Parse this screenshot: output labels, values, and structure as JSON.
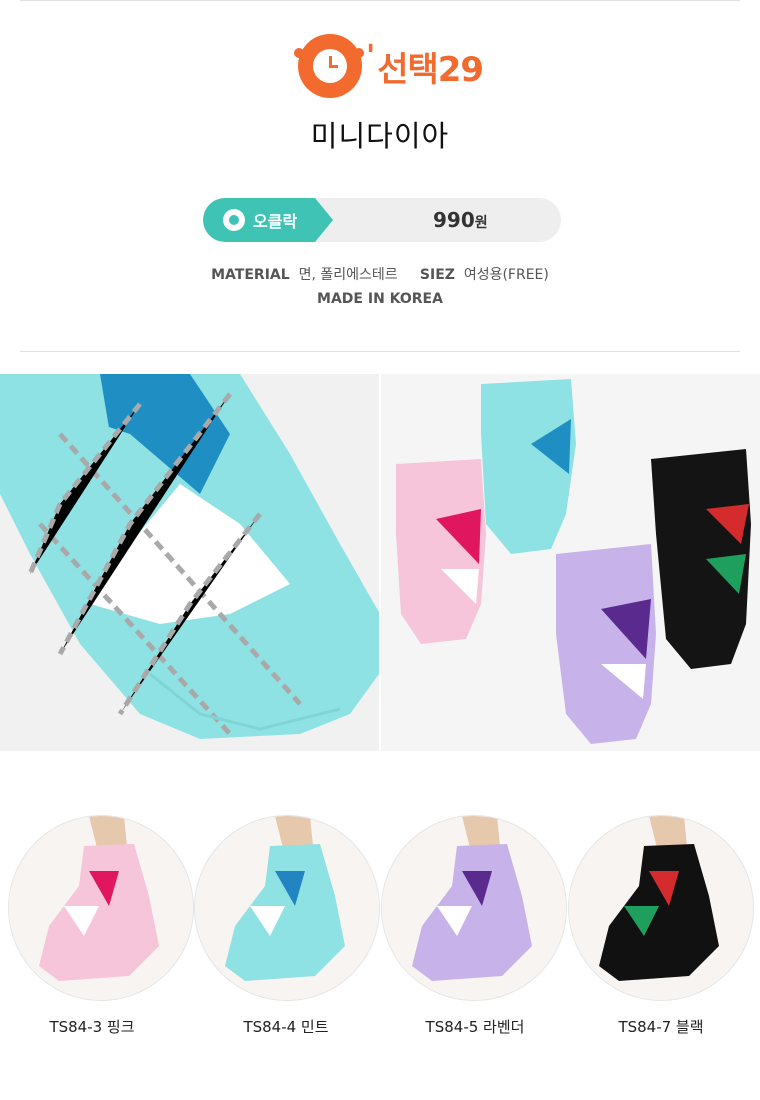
{
  "brand": {
    "name": "선택29",
    "accent": "#f26a2d"
  },
  "product": {
    "name": "미니다이아"
  },
  "price": {
    "badge_label": "오클락",
    "amount": "990",
    "unit": "원",
    "badge_color": "#3ec3b4"
  },
  "specs": {
    "material_label": "MATERIAL",
    "material_value": "면, 폴리에스테르",
    "size_label": "SIEZ",
    "size_value": "여성용(FREE)",
    "origin": "MADE IN KOREA"
  },
  "variants": [
    {
      "label": "TS84-3 핑크",
      "color": "#f6c5da",
      "accent": "#e0175f"
    },
    {
      "label": "TS84-4 민트",
      "color": "#8fe2e4",
      "accent": "#2285c2"
    },
    {
      "label": "TS84-5 라벤더",
      "color": "#c7b3ea",
      "accent": "#5b2a8f"
    },
    {
      "label": "TS84-7 블랙",
      "color": "#111111",
      "accent": "#d42c2c"
    }
  ]
}
